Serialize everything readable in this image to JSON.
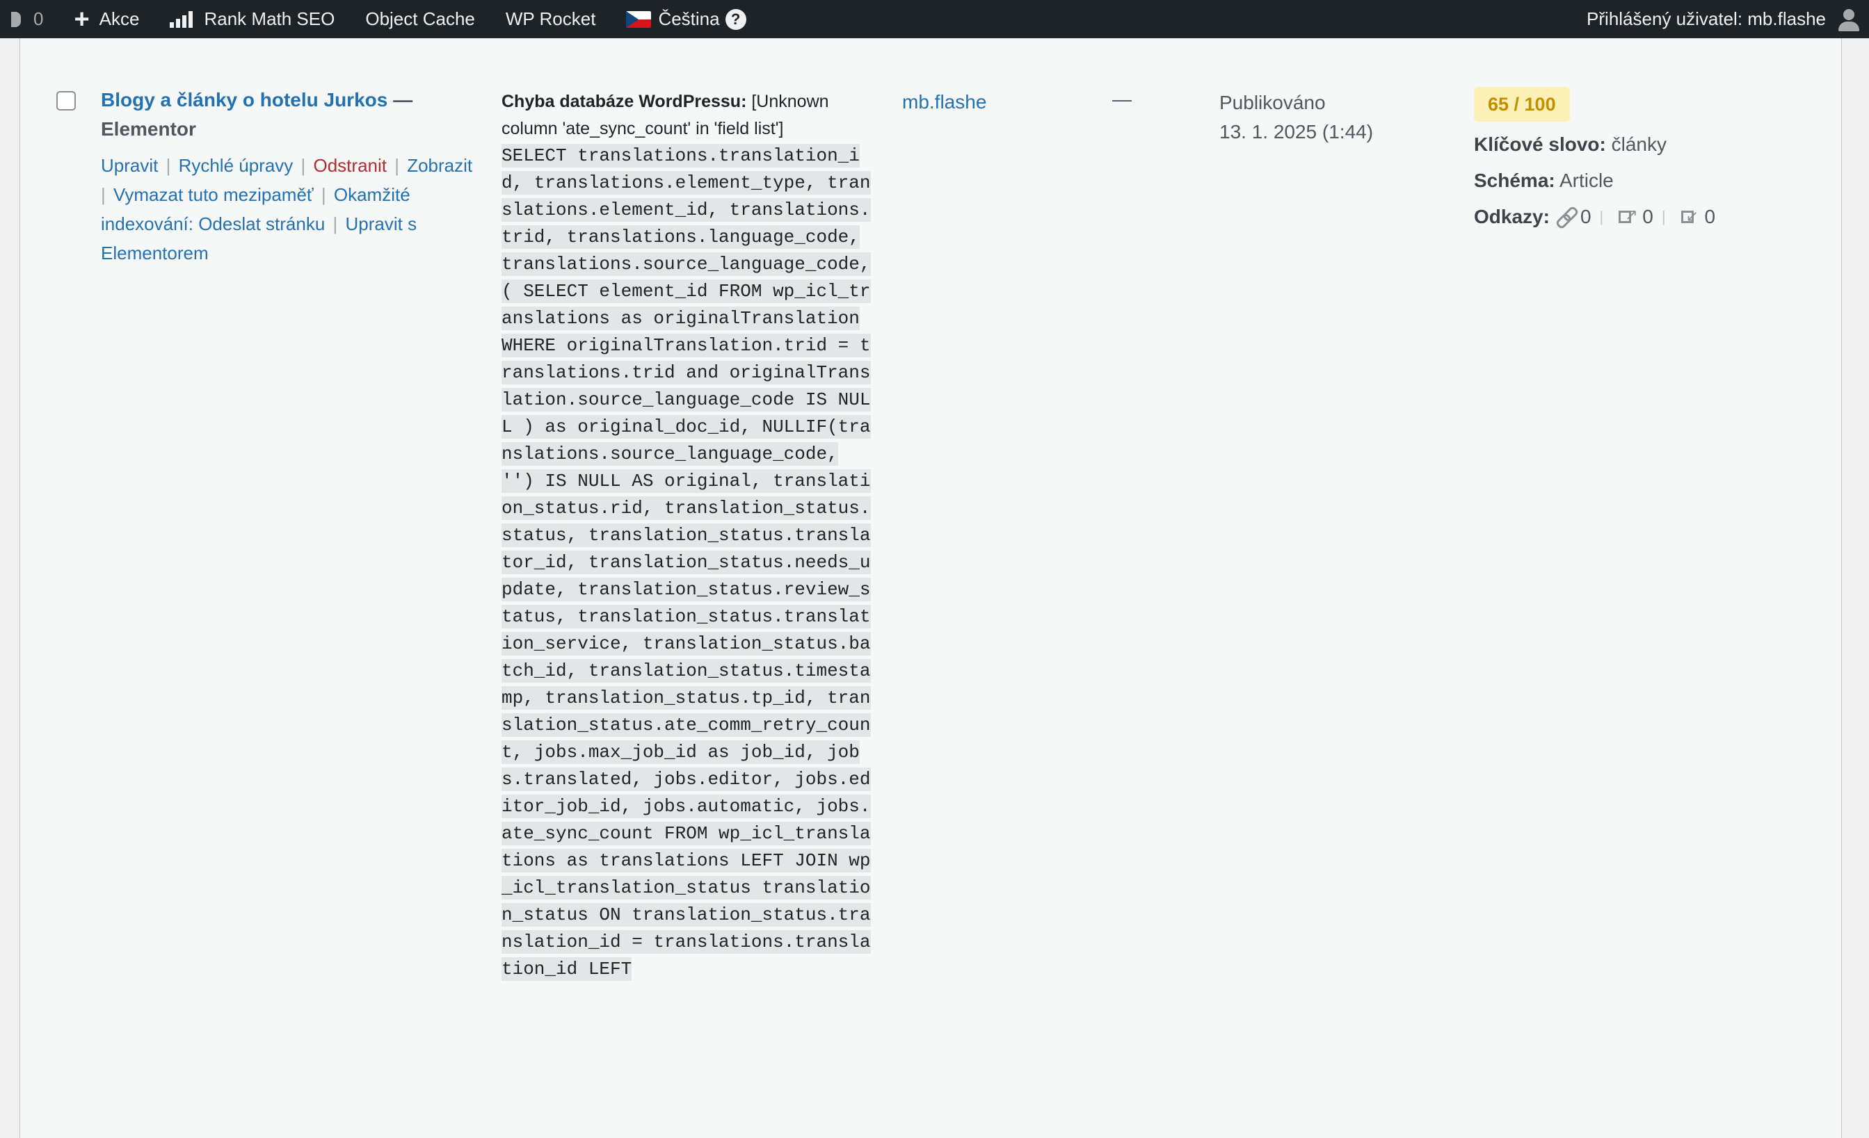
{
  "adminbar": {
    "comments_count": "0",
    "new_label": "Akce",
    "rankmath_label": "Rank Math SEO",
    "object_cache_label": "Object Cache",
    "wp_rocket_label": "WP Rocket",
    "language_label": "Čeština",
    "help_label": "?",
    "user_greeting": "Přihlášený uživatel: mb.flashe"
  },
  "row": {
    "title": "Blogy a články o hotelu Jurkos",
    "title_dash": "—",
    "title_state": "Elementor",
    "actions": {
      "edit": "Upravit",
      "quick_edit": "Rychlé úpravy",
      "delete": "Odstranit",
      "view": "Zobrazit",
      "clear_cache": "Vymazat tuto mezipaměť",
      "instant_index": "Okamžité indexování: Odeslat stránku",
      "edit_elementor": "Upravit s Elementorem"
    },
    "error_label": "Chyba databáze WordPressu:",
    "error_message": "[Unknown column 'ate_sync_count' in 'field list']",
    "sql": " SELECT translations.translation_id, translations.element_type, translations.element_id, translations.trid, translations.language_code, translations.source_language_code, ( SELECT element_id FROM wp_icl_translations as originalTranslation WHERE originalTranslation.trid = translations.trid and originalTranslation.source_language_code IS NULL ) as original_doc_id, NULLIF(translations.source_language_code, '') IS NULL AS original, translation_status.rid, translation_status.status, translation_status.translator_id, translation_status.needs_update, translation_status.review_status, translation_status.translation_service, translation_status.batch_id, translation_status.timestamp, translation_status.tp_id, translation_status.ate_comm_retry_count, jobs.max_job_id as job_id, jobs.translated, jobs.editor, jobs.editor_job_id, jobs.automatic, jobs.ate_sync_count FROM wp_icl_translations as translations LEFT JOIN wp_icl_translation_status translation_status ON translation_status.translation_id = translations.translation_id LEFT",
    "author": "mb.flashe",
    "comments": "—",
    "date_status": "Publikováno",
    "date_value": "13. 1. 2025 (1:44)",
    "seo": {
      "score": "65 / 100",
      "keyword_label": "Klíčové slovo:",
      "keyword_value": "články",
      "schema_label": "Schéma:",
      "schema_value": "Article",
      "links_label": "Odkazy:",
      "internal": "0",
      "external": "0",
      "incoming": "0",
      "icons": [
        "link-icon",
        "external-link-icon",
        "incoming-link-icon"
      ]
    }
  },
  "colors": {
    "adminbar_bg": "#1d2327",
    "link": "#2271b1",
    "delete": "#b32d2e",
    "score_bg": "#fdf0b6",
    "score_text": "#c28f00"
  }
}
